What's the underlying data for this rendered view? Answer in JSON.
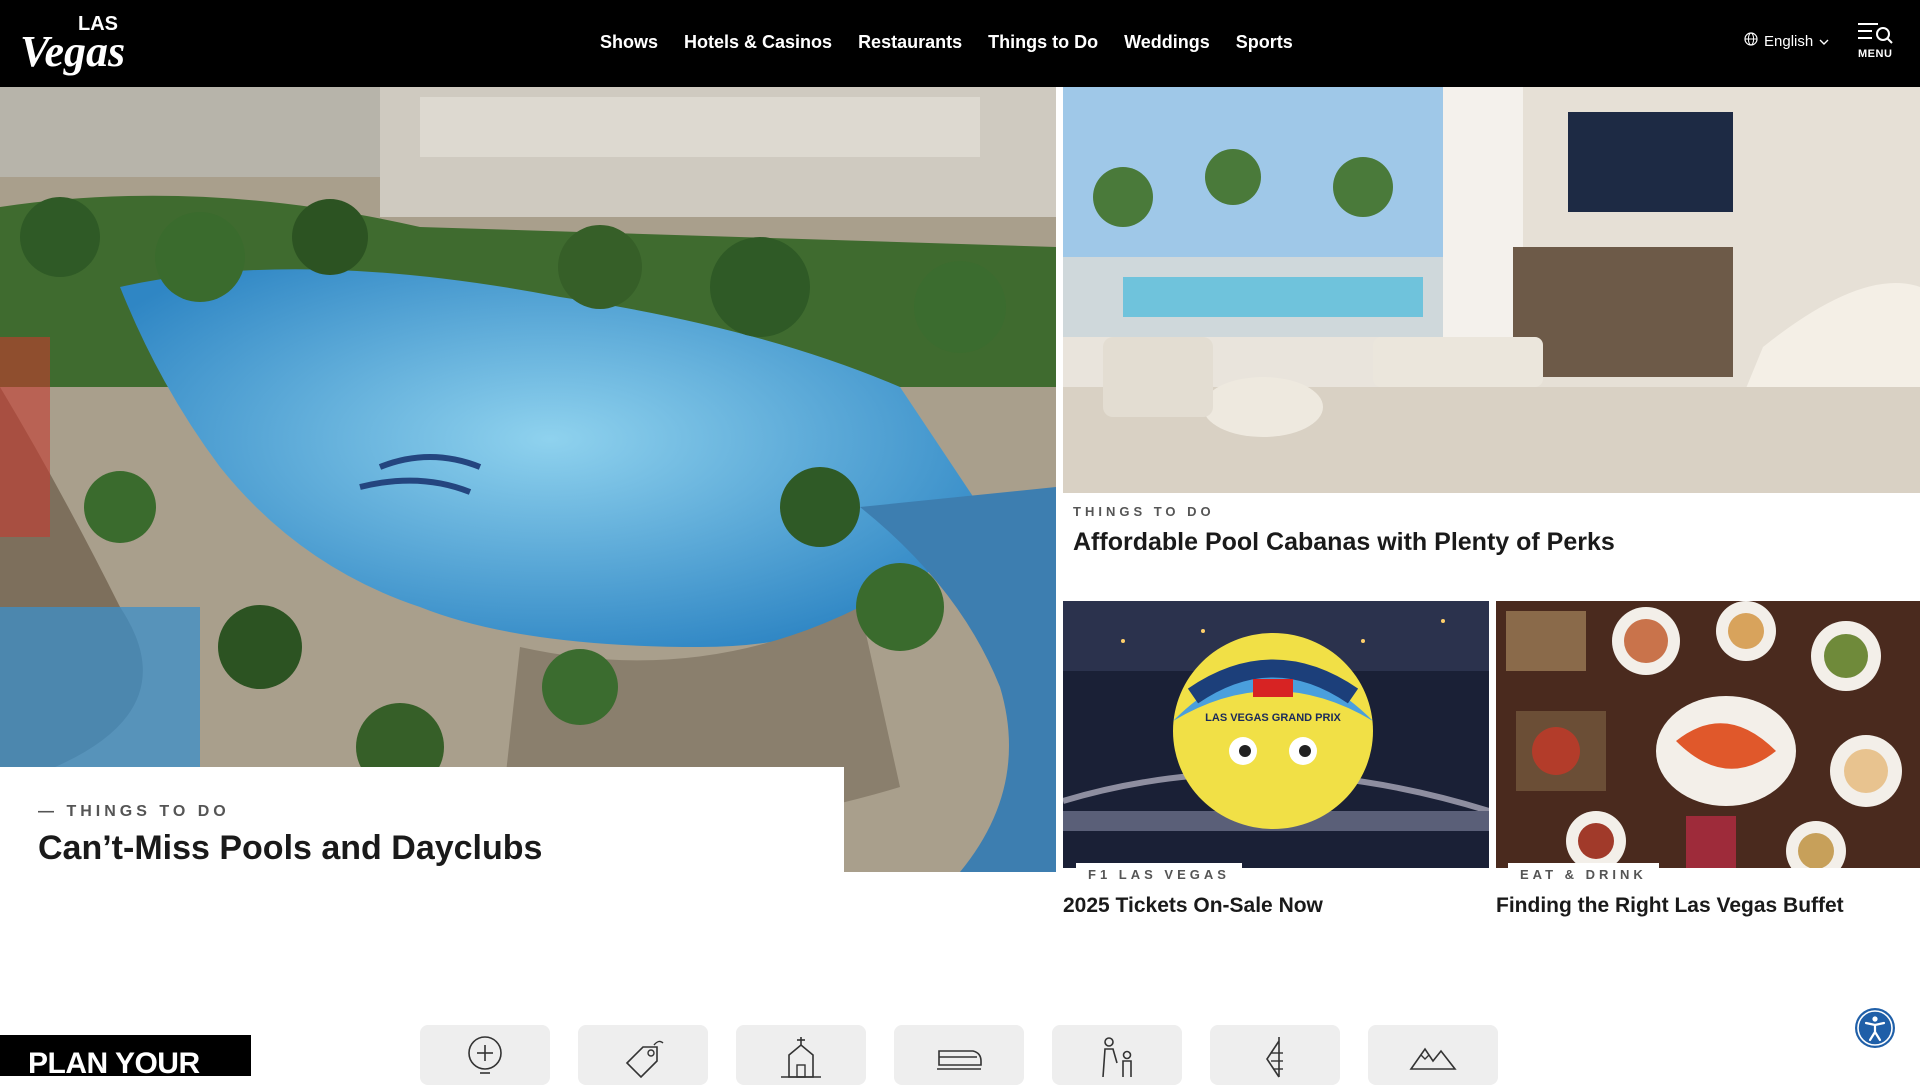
{
  "header": {
    "logo_top": "LAS",
    "logo_script": "Vegas",
    "nav": [
      "Shows",
      "Hotels & Casinos",
      "Restaurants",
      "Things to Do",
      "Weddings",
      "Sports"
    ],
    "language": "English",
    "menu_label": "MENU"
  },
  "feature": {
    "eyebrow": "— THINGS TO DO",
    "title": "Can’t-Miss Pools and Dayclubs"
  },
  "cards": [
    {
      "eyebrow": "THINGS TO DO",
      "title": "Affordable Pool Cabanas with Plenty of Perks"
    },
    {
      "eyebrow": "F1 LAS VEGAS",
      "title": "2025 Tickets On-Sale Now",
      "sphere_text": "LAS VEGAS GRAND PRIX"
    },
    {
      "eyebrow": "EAT & DRINK",
      "title": "Finding the Right Las Vegas Buffet"
    }
  ],
  "plan": {
    "label": "PLAN YOUR TRIP"
  },
  "icons": [
    "lightbulb-plus-icon",
    "tag-icon",
    "chapel-icon",
    "shuttle-icon",
    "family-icon",
    "skyline-tower-icon",
    "mountains-icon"
  ],
  "colors": {
    "header_bg": "#000000",
    "accessibility": "#1f5fa8",
    "tile_bg": "#eeeeee"
  }
}
